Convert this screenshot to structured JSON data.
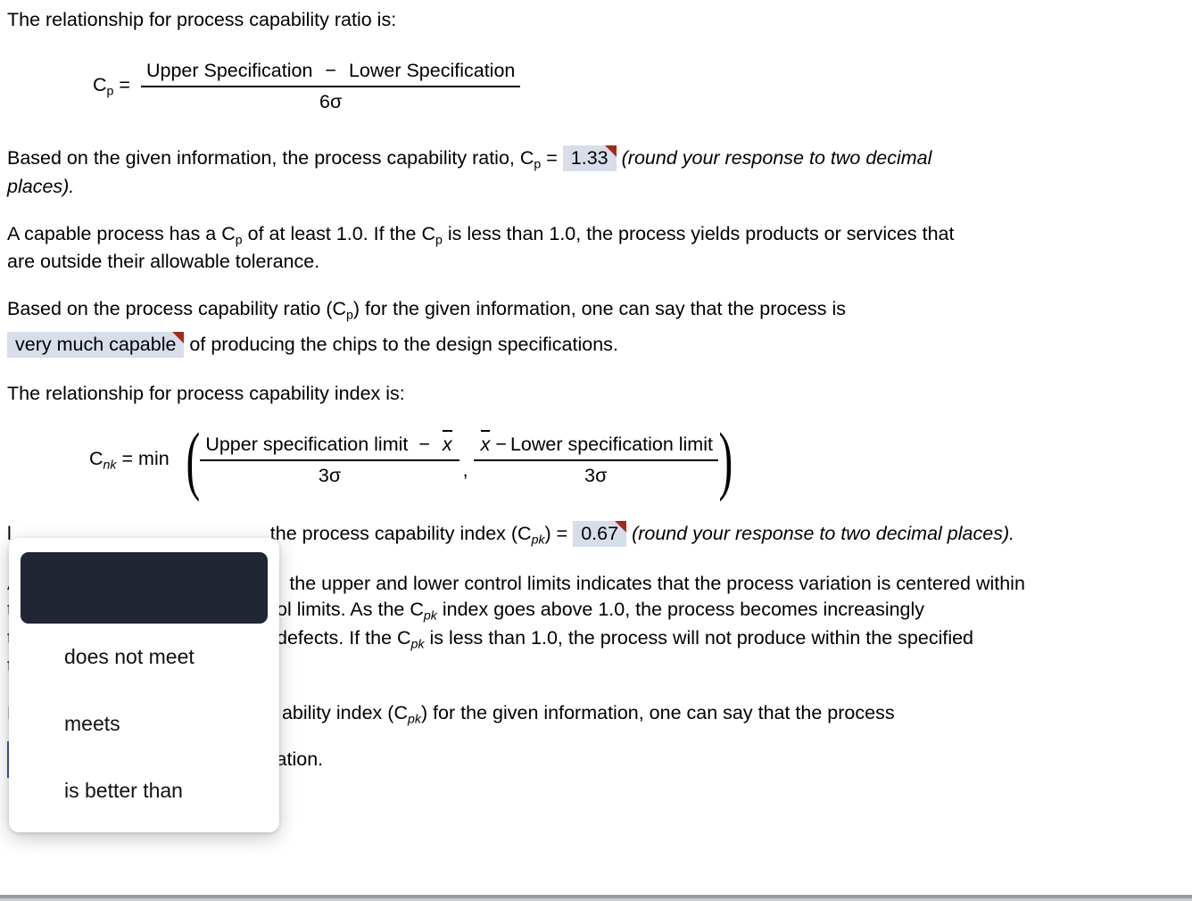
{
  "intro": {
    "cp_relationship_text": "The relationship for process capability ratio is:"
  },
  "cp_formula": {
    "lhs_symbol": "C",
    "lhs_sub": "p",
    "equals": "=",
    "numerator_left": "Upper Specification",
    "numerator_minus": "−",
    "numerator_right": "Lower Specification",
    "denominator": "6σ"
  },
  "cp_answer_para": {
    "before": "Based on the given information, the process capability ratio, C",
    "sub": "p",
    "equals": " = ",
    "answer_value": "1.33",
    "after_italic": "(round your response to two decimal",
    "second_line_italic": "places)."
  },
  "capable_para": {
    "line1_a": "A capable process has a C",
    "line1_sub1": "p",
    "line1_b": " of at least 1.0. If the C",
    "line1_sub2": "p",
    "line1_c": "  is less than 1.0, the process yields products or services that",
    "line2": "are outside their allowable tolerance."
  },
  "cp_conclusion": {
    "line1_a": "Based on the process capability ratio (C",
    "line1_sub": "p",
    "line1_b": ") for the given information, one can say that the process is",
    "answer_value": "very much capable",
    "line2_after": " of producing the chips to the design specifications."
  },
  "cpk_intro": {
    "text": "The relationship for process capability index is:"
  },
  "cpk_formula": {
    "lhs_symbol": "C",
    "lhs_sub": "nk",
    "lhs_rest": "= min",
    "left_paren": "(",
    "right_paren": ")",
    "num1_a": "Upper specification limit",
    "num1_minus": "−",
    "num1_xbar": "x",
    "den1": "3σ",
    "comma": ",",
    "num2_xbar": "x",
    "num2_minus": "−",
    "num2_b": "Lower specification limit",
    "den2": "3σ"
  },
  "cpk_answer_para": {
    "hidden_prefix": "l",
    "visible": "the process capability index (C",
    "sub": "pk",
    "equals": ") = ",
    "answer_value": "0.67",
    "after_italic": "(round your response to two decimal places)."
  },
  "cpk_explain": {
    "line1_hidden": "A",
    "line1": " the upper and lower control limits indicates that the process variation is centered within",
    "line2_hidden": "t",
    "line2_a": "ol limits. As the C",
    "line2_sub": "pk",
    "line2_b": " index goes above 1.0, the process becomes increasingly",
    "line3_hidden": "t",
    "line3_a": "defects. If the C",
    "line3_sub": "pk",
    "line3_b": " is less than 1.0, the process will not produce within the specified",
    "line4_hidden": "t"
  },
  "cpk_conclusion": {
    "hidden_prefix": "L",
    "line_a": "ability index (C",
    "line_sub": "pk",
    "line_b": ") for the given information, one can say that the process",
    "select_value": "",
    "after_select": "the specification."
  },
  "dropdown": {
    "selected_option_label": "",
    "options": [
      "does not meet",
      "meets",
      "is better than"
    ]
  },
  "colors": {
    "answer_fill": "#d7deea",
    "answer_corner": "#a52a1e",
    "select_border": "#3b5bb5",
    "dropdown_selected_bg": "#212634",
    "page_bg": "#ffffff",
    "bottom_rule": "#9a9aa8"
  }
}
